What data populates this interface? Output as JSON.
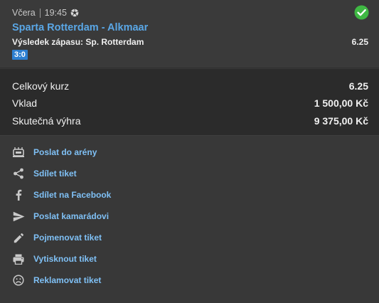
{
  "ticket": {
    "day": "Včera",
    "time": "19:45",
    "match": "Sparta Rotterdam - Alkmaar",
    "result_text": "Výsledek zápasu: Sp. Rotterdam",
    "odd": "6.25",
    "score": "3:0",
    "status_icon": "check-circle-icon",
    "sport_icon": "football-icon"
  },
  "summary": {
    "total_odds_label": "Celkový kurz",
    "total_odds_value": "6.25",
    "stake_label": "Vklad",
    "stake_value": "1 500,00 Kč",
    "win_label": "Skutečná výhra",
    "win_value": "9 375,00 Kč"
  },
  "actions": [
    {
      "label": "Poslat do arény",
      "icon": "arena-icon"
    },
    {
      "label": "Sdílet tiket",
      "icon": "share-icon"
    },
    {
      "label": "Sdílet na Facebook",
      "icon": "facebook-icon"
    },
    {
      "label": "Poslat kamarádovi",
      "icon": "send-icon"
    },
    {
      "label": "Pojmenovat tiket",
      "icon": "pencil-icon"
    },
    {
      "label": "Vytisknout tiket",
      "icon": "printer-icon"
    },
    {
      "label": "Reklamovat tiket",
      "icon": "sad-face-icon"
    }
  ],
  "colors": {
    "accent": "#5aa7e6",
    "link": "#7fc0f5",
    "success": "#3fb843",
    "score_badge": "#2d7fd0"
  }
}
